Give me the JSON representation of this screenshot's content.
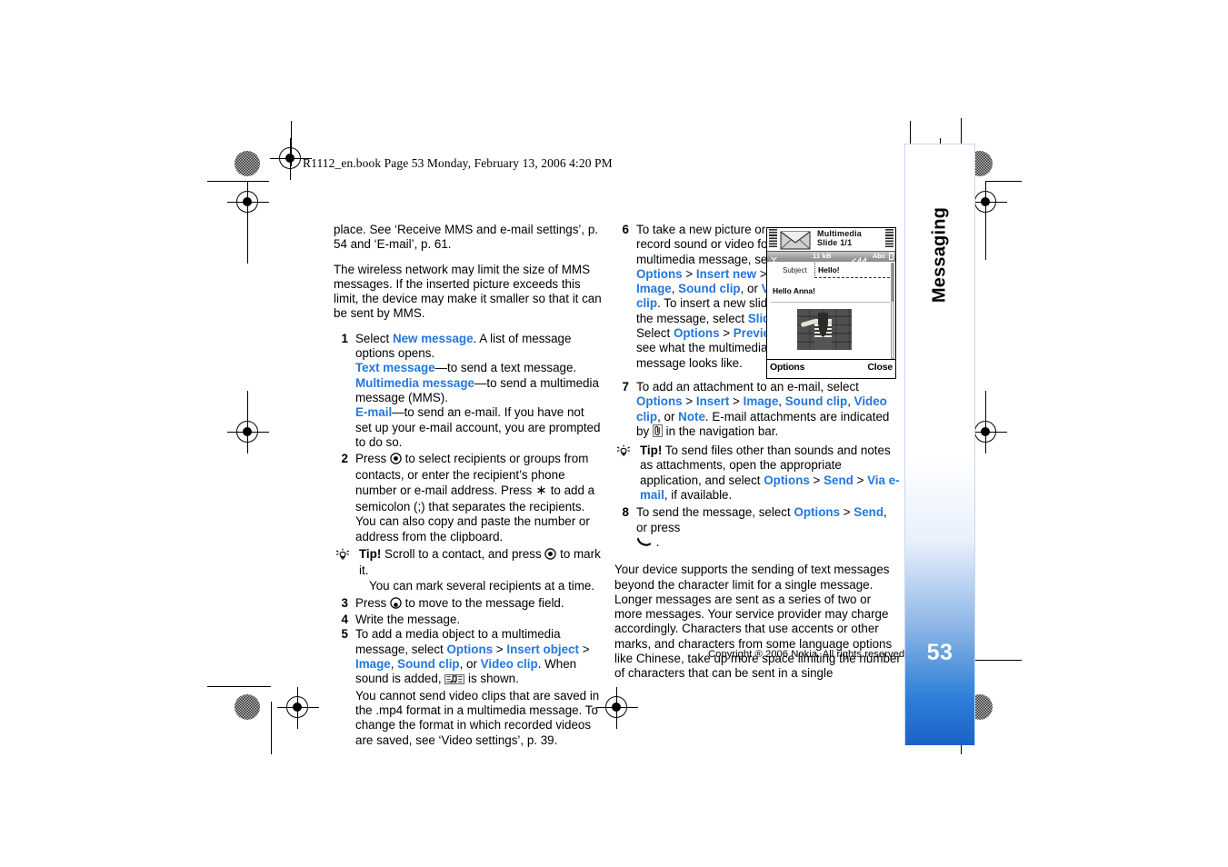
{
  "page": {
    "file_header": "R1112_en.book  Page 53  Monday, February 13, 2006  4:20 PM",
    "page_number": "53",
    "section_tab": "Messaging",
    "copyright": "Copyright ® 2006 Nokia. All rights reserved.",
    "link_color": "#2277dd"
  },
  "left_column": {
    "para_place": "place. See ‘Receive MMS and e-mail settings’, p. 54 and ‘E-mail’, p. 61.",
    "para_network": "The wireless network may limit the size of MMS messages. If the inserted picture exceeds this limit, the device may make it smaller so that it can be sent by MMS.",
    "step1": {
      "num": "1",
      "lead": "Select ",
      "link_new_message": "New message",
      "after": ". A list of message options opens.",
      "line_text_message_link": "Text message",
      "line_text_message_rest": "—to send a text message.",
      "line_mms_link": "Multimedia message",
      "line_mms_rest": "—to send a multimedia message (MMS).",
      "line_email_link": "E-mail",
      "line_email_rest": "—to send an e-mail. If you have not set up your e-mail account, you are prompted to do so."
    },
    "step2": {
      "num": "2",
      "part1": "Press ",
      "part2": " to select recipients or groups from contacts, or enter the recipient’s phone number or e-mail address. Press ",
      "part3": " to add a semicolon (;) that separates the recipients. You can also copy and paste the number or address from the clipboard."
    },
    "tip1": {
      "label": "Tip!",
      "part1": " Scroll to a contact, and press ",
      "part2": " to mark it.",
      "part3": "You can mark several recipients at a time."
    },
    "step3": {
      "num": "3",
      "part1": "Press ",
      "part2": " to move to the message field."
    },
    "step4": {
      "num": "4",
      "text": "Write the message."
    },
    "step5": {
      "num": "5",
      "lead": "To add a media object to a multimedia message, select ",
      "l_options": "Options",
      "l_insert_object": "Insert object",
      "l_image": "Image",
      "l_sound_clip": "Sound clip",
      "l_video_clip": "Video clip",
      "mid": ", or ",
      "after_icon_pre": ". When sound is added, ",
      "after_icon_post": " is shown.",
      "tail": "You cannot send video clips that are saved in the .mp4 format in a multimedia message. To change the format in which recorded videos are saved, see ‘Video settings’, p. 39."
    }
  },
  "right_column": {
    "step6": {
      "num": "6",
      "p1": "To take a new picture or record sound or video for a multimedia message, select ",
      "l_options": "Options",
      "l_insert_new": "Insert new",
      "l_image": "Image",
      "l_sound_clip": "Sound clip",
      "l_video_clip": "Video clip",
      "p2": ". To insert a new slide to the message, select ",
      "l_slide": "Slide",
      "p3": ". Select ",
      "l_options2": "Options",
      "l_preview": "Preview",
      "p4": " to see what the multimedia message looks like."
    },
    "step7": {
      "num": "7",
      "p1": "To add an attachment to an e-mail, select ",
      "l_options": "Options",
      "l_insert": "Insert",
      "l_image": "Image",
      "l_sound_clip": "Sound clip",
      "l_video_clip": "Video clip",
      "l_note": "Note",
      "p2": ". E-mail attachments are indicated by ",
      "p3": " in the navigation bar."
    },
    "tip2": {
      "label": "Tip!",
      "p1": " To send files other than sounds and notes as attachments, open the appropriate application, and select ",
      "l_options": "Options",
      "l_send": "Send",
      "l_via_email": "Via e-mail",
      "p2": ", if available."
    },
    "step8": {
      "num": "8",
      "p1": "To send the message, select ",
      "l_options": "Options",
      "l_send": "Send",
      "p2": ", or press ",
      "p3": " ."
    },
    "closing_para": "Your device supports the sending of text messages beyond the character limit for a single message. Longer messages are sent as a series of two or more messages. Your service provider may charge accordingly. Characters that use accents or other marks, and characters from some language options like Chinese, take up more space limiting the number of characters that can be sent in a single"
  },
  "phone_screenshot": {
    "title_line1": "Multimedia",
    "title_line2": "Slide 1/1",
    "status_size": "11 kB",
    "status_mode": "Abc",
    "subject_label": "Subject",
    "subject_value": "Hello!",
    "message_body": "Hello Anna!",
    "softkey_left": "Options",
    "softkey_right": "Close"
  }
}
